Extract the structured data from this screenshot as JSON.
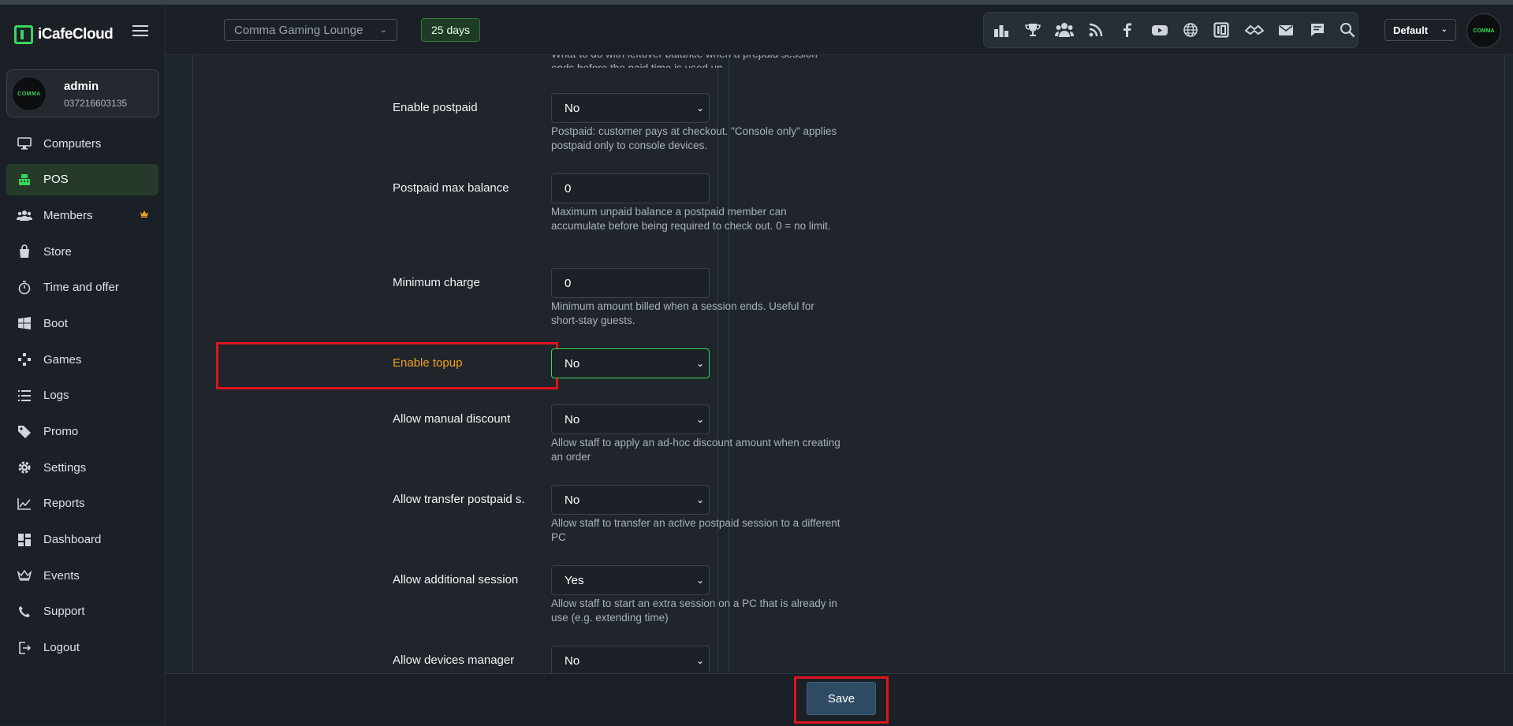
{
  "brand": {
    "name": "iCafeCloud",
    "logo_icon": "icafecloud-logo-icon"
  },
  "user": {
    "name": "admin",
    "phone": "037216603135",
    "avatar_text": "COMMA"
  },
  "nav": [
    {
      "label": "Computers",
      "icon": "monitor-icon",
      "active": false
    },
    {
      "label": "POS",
      "icon": "cash-register-icon",
      "active": true
    },
    {
      "label": "Members",
      "icon": "users-icon",
      "active": false,
      "badge": "crown-icon"
    },
    {
      "label": "Store",
      "icon": "bag-icon",
      "active": false
    },
    {
      "label": "Time and offer",
      "icon": "stopwatch-icon",
      "active": false
    },
    {
      "label": "Boot",
      "icon": "windows-icon",
      "active": false
    },
    {
      "label": "Games",
      "icon": "gamepad-icon",
      "active": false
    },
    {
      "label": "Logs",
      "icon": "list-icon",
      "active": false
    },
    {
      "label": "Promo",
      "icon": "tag-icon",
      "active": false
    },
    {
      "label": "Settings",
      "icon": "gear-icon",
      "active": false
    },
    {
      "label": "Reports",
      "icon": "chart-line-icon",
      "active": false
    },
    {
      "label": "Dashboard",
      "icon": "dashboard-icon",
      "active": false
    },
    {
      "label": "Events",
      "icon": "crown-icon",
      "active": false
    },
    {
      "label": "Support",
      "icon": "phone-icon",
      "active": false
    },
    {
      "label": "Logout",
      "icon": "logout-icon",
      "active": false
    }
  ],
  "header": {
    "venue": "Comma Gaming Lounge",
    "days_badge": "25 days",
    "profile": "Default",
    "avatar_text": "COMMA",
    "icons": [
      "leaderboard-icon",
      "trophy-icon",
      "group-icon",
      "rss-icon",
      "facebook-icon",
      "youtube-icon",
      "globe-icon",
      "icafecloud-icon",
      "handshake-icon",
      "mail-icon",
      "chat-icon",
      "search-icon"
    ]
  },
  "form": {
    "top_desc": "What to do with leftover balance when a prepaid session ends before the paid time is used up",
    "top_desc_partial": "ends before the paid time is used up",
    "rows": [
      {
        "label": "Enable postpaid",
        "value": "No",
        "type": "select",
        "desc": "Postpaid: customer pays at checkout. \"Console only\" applies postpaid only to console devices."
      },
      {
        "label": "Postpaid max balance",
        "value": "0",
        "type": "input",
        "desc": "Maximum unpaid balance a postpaid member can accumulate before being required to check out. 0 = no limit."
      },
      {
        "label": "Minimum charge",
        "value": "0",
        "type": "input",
        "desc": "Minimum amount billed when a session ends. Useful for short-stay guests."
      },
      {
        "label": "Enable topup",
        "value": "No",
        "type": "select",
        "desc": ""
      },
      {
        "label": "Allow manual discount",
        "value": "No",
        "type": "select",
        "desc": "Allow staff to apply an ad-hoc discount amount when creating an order"
      },
      {
        "label": "Allow transfer postpaid s...",
        "value": "No",
        "type": "select",
        "desc": "Allow staff to transfer an active postpaid session to a different PC"
      },
      {
        "label": "Allow additional session",
        "value": "Yes",
        "type": "select",
        "desc": "Allow staff to start an extra session on a PC that is already in use (e.g. extending time)"
      },
      {
        "label": "Allow devices manager",
        "value": "No",
        "type": "select",
        "desc": ""
      }
    ]
  },
  "footer": {
    "save_label": "Save"
  },
  "colors": {
    "accent_green": "#3ad65b",
    "highlight_label": "#f0a020",
    "annotation_red": "#e0141c",
    "save_button": "#2f4a63"
  }
}
